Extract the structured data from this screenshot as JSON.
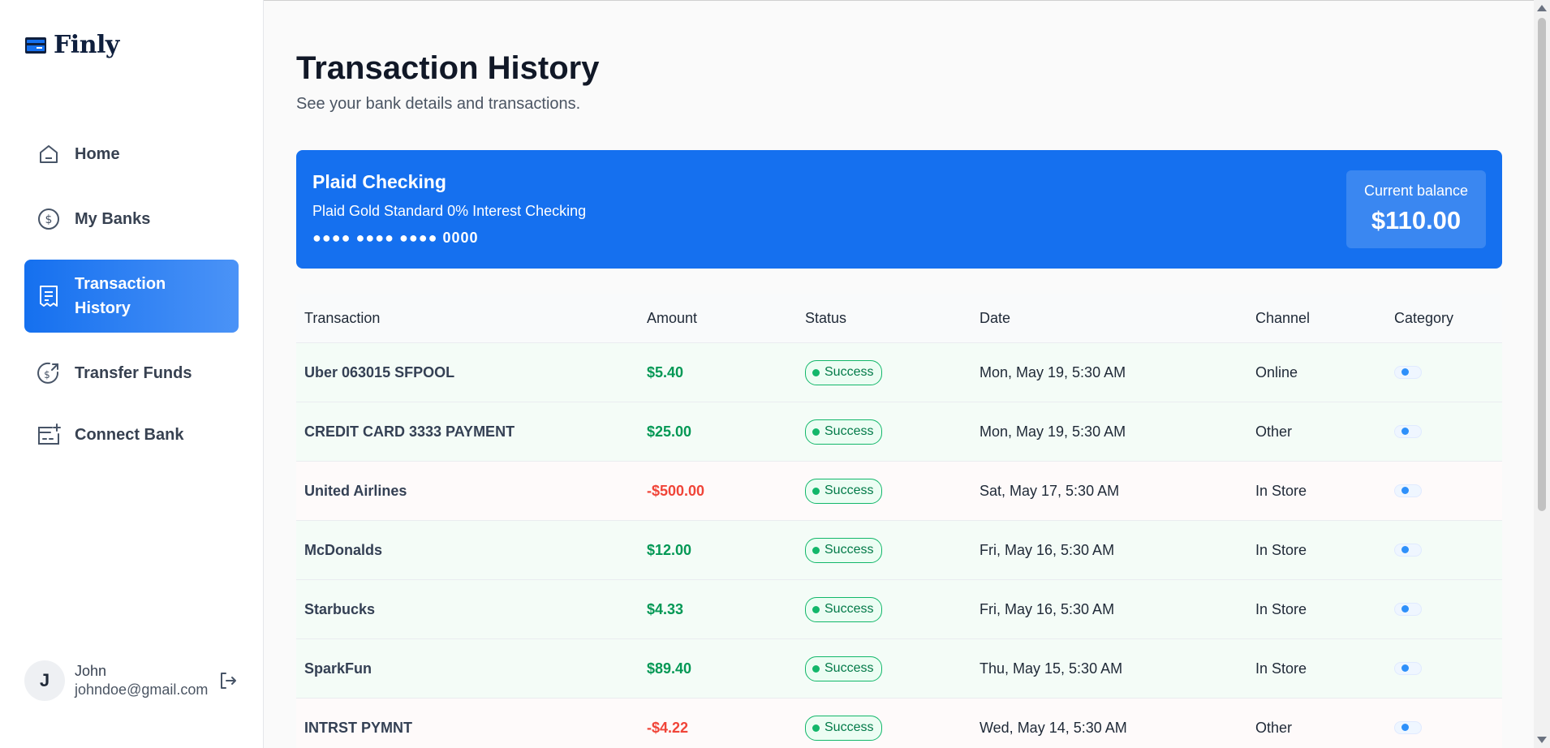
{
  "app": {
    "name": "Finly"
  },
  "sidebar": {
    "items": [
      {
        "label": "Home",
        "icon": "home-icon",
        "active": false
      },
      {
        "label": "My Banks",
        "icon": "dollar-circle-icon",
        "active": false
      },
      {
        "label": "Transaction History",
        "icon": "receipt-icon",
        "active": true
      },
      {
        "label": "Transfer Funds",
        "icon": "money-send-icon",
        "active": false
      },
      {
        "label": "Connect Bank",
        "icon": "card-add-icon",
        "active": false
      }
    ],
    "user": {
      "initial": "J",
      "name": "John",
      "email": "johndoe@gmail.com"
    }
  },
  "page": {
    "title": "Transaction History",
    "subtitle": "See your bank details and transactions."
  },
  "bank": {
    "name": "Plaid Checking",
    "official_name": "Plaid Gold Standard 0% Interest Checking",
    "mask": "●●●● ●●●● ●●●● 0000",
    "balance_label": "Current balance",
    "balance": "$110.00"
  },
  "table": {
    "headers": [
      "Transaction",
      "Amount",
      "Status",
      "Date",
      "Channel",
      "Category"
    ],
    "rows": [
      {
        "name": "Uber 063015 SFPOOL",
        "amount": "$5.40",
        "type": "pos",
        "status": "Success",
        "date": "Mon, May 19, 5:30 AM",
        "channel": "Online"
      },
      {
        "name": "CREDIT CARD 3333 PAYMENT",
        "amount": "$25.00",
        "type": "pos",
        "status": "Success",
        "date": "Mon, May 19, 5:30 AM",
        "channel": "Other"
      },
      {
        "name": "United Airlines",
        "amount": "-$500.00",
        "type": "neg",
        "status": "Success",
        "date": "Sat, May 17, 5:30 AM",
        "channel": "In Store"
      },
      {
        "name": "McDonalds",
        "amount": "$12.00",
        "type": "pos",
        "status": "Success",
        "date": "Fri, May 16, 5:30 AM",
        "channel": "In Store"
      },
      {
        "name": "Starbucks",
        "amount": "$4.33",
        "type": "pos",
        "status": "Success",
        "date": "Fri, May 16, 5:30 AM",
        "channel": "In Store"
      },
      {
        "name": "SparkFun",
        "amount": "$89.40",
        "type": "pos",
        "status": "Success",
        "date": "Thu, May 15, 5:30 AM",
        "channel": "In Store"
      },
      {
        "name": "INTRST PYMNT",
        "amount": "-$4.22",
        "type": "neg",
        "status": "Success",
        "date": "Wed, May 14, 5:30 AM",
        "channel": "Other"
      }
    ]
  },
  "colors": {
    "primary": "#1570ef",
    "success": "#12b76a",
    "positive_amount": "#039855",
    "negative_amount": "#f04438"
  }
}
